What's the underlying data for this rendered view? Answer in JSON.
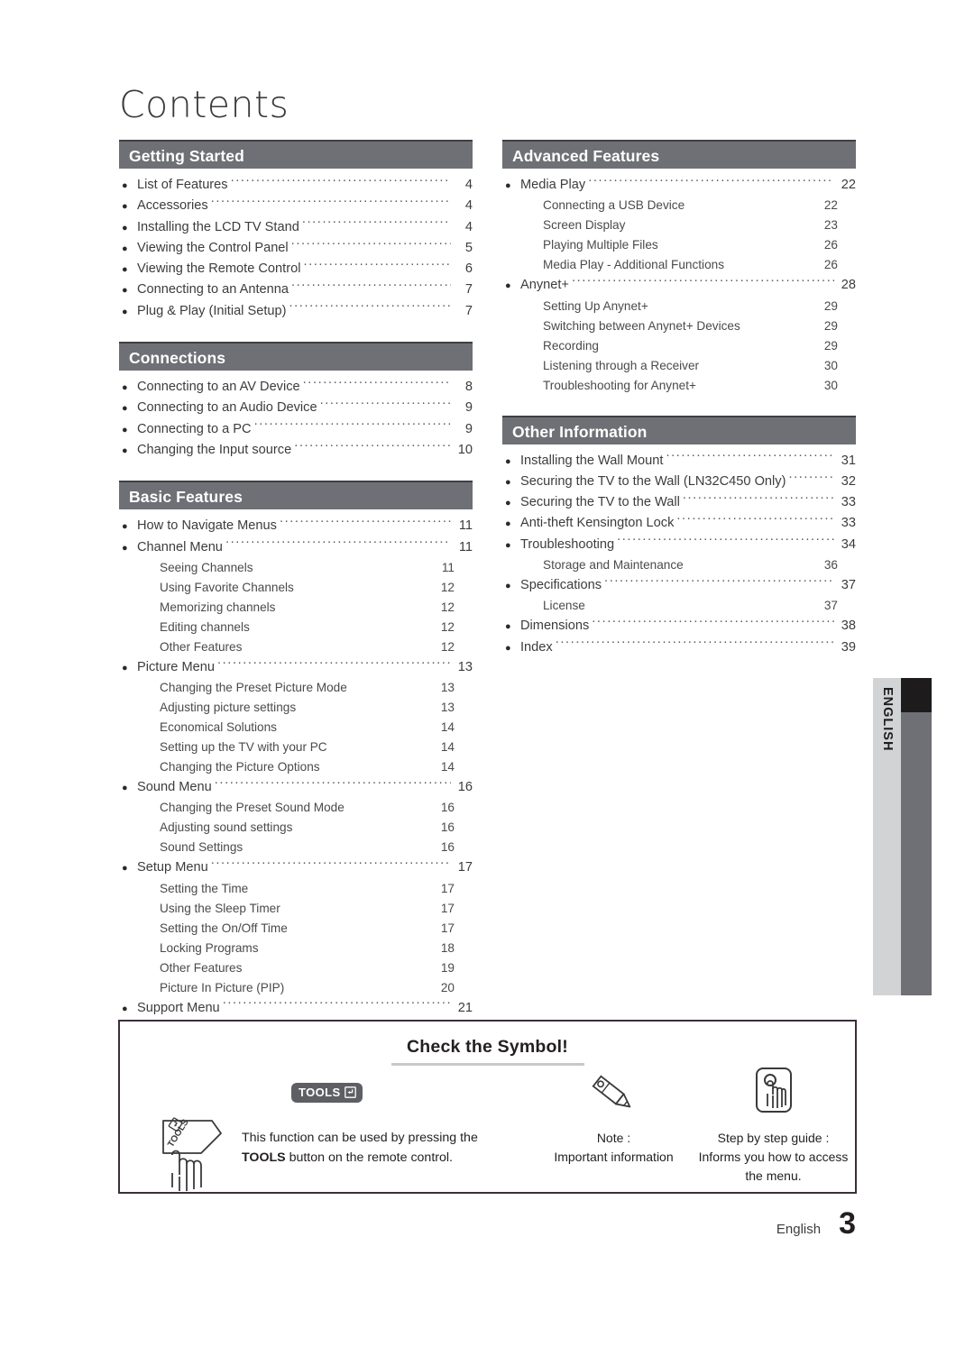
{
  "page": {
    "title": "Contents",
    "footer_language": "English",
    "footer_page_number": "3",
    "side_tab_language": "ENGLISH",
    "accent_bar_color": "#6e7075",
    "bar_top_border_color": "#3f4043",
    "side_tab_bg_color": "#d2d3d5",
    "side_tab_black_color": "#1e1b1c"
  },
  "columns": {
    "left": [
      {
        "heading": "Getting Started",
        "entries": [
          {
            "type": "main",
            "label": "List of Features",
            "page": "4"
          },
          {
            "type": "main",
            "label": "Accessories",
            "page": "4"
          },
          {
            "type": "main",
            "label": "Installing the LCD TV Stand",
            "page": "4"
          },
          {
            "type": "main",
            "label": "Viewing the Control Panel",
            "page": "5"
          },
          {
            "type": "main",
            "label": "Viewing the Remote Control",
            "page": "6"
          },
          {
            "type": "main",
            "label": "Connecting to an Antenna",
            "page": "7"
          },
          {
            "type": "main",
            "label": "Plug & Play (Initial Setup)",
            "page": "7"
          }
        ]
      },
      {
        "heading": "Connections",
        "entries": [
          {
            "type": "main",
            "label": "Connecting to an AV Device",
            "page": "8"
          },
          {
            "type": "main",
            "label": "Connecting to an Audio Device",
            "page": "9"
          },
          {
            "type": "main",
            "label": "Connecting to a PC",
            "page": "9"
          },
          {
            "type": "main",
            "label": "Changing the Input source",
            "page": "10"
          }
        ]
      },
      {
        "heading": "Basic Features",
        "entries": [
          {
            "type": "main",
            "label": "How to Navigate Menus",
            "page": "11"
          },
          {
            "type": "main",
            "label": "Channel Menu",
            "page": "11"
          },
          {
            "type": "sub",
            "label": "Seeing Channels",
            "page": "11"
          },
          {
            "type": "sub",
            "label": "Using Favorite Channels",
            "page": "12"
          },
          {
            "type": "sub",
            "label": "Memorizing channels",
            "page": "12"
          },
          {
            "type": "sub",
            "label": "Editing channels",
            "page": "12"
          },
          {
            "type": "sub",
            "label": "Other Features",
            "page": "12"
          },
          {
            "type": "main",
            "label": "Picture Menu",
            "page": "13"
          },
          {
            "type": "sub",
            "label": "Changing the Preset Picture Mode",
            "page": "13"
          },
          {
            "type": "sub",
            "label": "Adjusting picture settings",
            "page": "13"
          },
          {
            "type": "sub",
            "label": "Economical Solutions",
            "page": "14"
          },
          {
            "type": "sub",
            "label": "Setting up the TV with your PC",
            "page": "14"
          },
          {
            "type": "sub",
            "label": "Changing the Picture Options",
            "page": "14"
          },
          {
            "type": "main",
            "label": "Sound Menu",
            "page": "16"
          },
          {
            "type": "sub",
            "label": "Changing the Preset Sound Mode",
            "page": "16"
          },
          {
            "type": "sub",
            "label": "Adjusting sound settings",
            "page": "16"
          },
          {
            "type": "sub",
            "label": "Sound Settings",
            "page": "16"
          },
          {
            "type": "main",
            "label": "Setup Menu",
            "page": "17"
          },
          {
            "type": "sub",
            "label": "Setting the Time",
            "page": "17"
          },
          {
            "type": "sub",
            "label": "Using the Sleep Timer",
            "page": "17"
          },
          {
            "type": "sub",
            "label": "Setting the On/Off Time",
            "page": "17"
          },
          {
            "type": "sub",
            "label": "Locking Programs",
            "page": "18"
          },
          {
            "type": "sub",
            "label": "Other Features",
            "page": "19"
          },
          {
            "type": "sub",
            "label": "Picture In Picture (PIP)",
            "page": "20"
          },
          {
            "type": "main",
            "label": "Support Menu",
            "page": "21"
          }
        ]
      }
    ],
    "right": [
      {
        "heading": "Advanced Features",
        "entries": [
          {
            "type": "main",
            "label": "Media Play",
            "page": "22"
          },
          {
            "type": "sub",
            "label": "Connecting a USB Device",
            "page": "22"
          },
          {
            "type": "sub",
            "label": "Screen Display",
            "page": "23"
          },
          {
            "type": "sub",
            "label": "Playing Multiple Files",
            "page": "26"
          },
          {
            "type": "sub",
            "label": "Media Play - Additional Functions",
            "page": "26"
          },
          {
            "type": "main",
            "label": "Anynet+",
            "page": "28"
          },
          {
            "type": "sub",
            "label": "Setting Up Anynet+",
            "page": "29"
          },
          {
            "type": "sub",
            "label": "Switching between Anynet+ Devices",
            "page": "29"
          },
          {
            "type": "sub",
            "label": "Recording",
            "page": "29"
          },
          {
            "type": "sub",
            "label": "Listening through a Receiver",
            "page": "30"
          },
          {
            "type": "sub",
            "label": "Troubleshooting for Anynet+",
            "page": "30"
          }
        ]
      },
      {
        "heading": "Other Information",
        "entries": [
          {
            "type": "main",
            "label": "Installing the Wall Mount",
            "page": "31"
          },
          {
            "type": "main",
            "label": "Securing the TV to the Wall (LN32C450 Only)",
            "page": "32"
          },
          {
            "type": "main",
            "label": "Securing the TV to the Wall",
            "page": "33"
          },
          {
            "type": "main",
            "label": "Anti-theft Kensington Lock",
            "page": "33"
          },
          {
            "type": "main",
            "label": "Troubleshooting",
            "page": "34"
          },
          {
            "type": "sub",
            "label": "Storage and Maintenance",
            "page": "36"
          },
          {
            "type": "main",
            "label": "Specifications",
            "page": "37"
          },
          {
            "type": "sub",
            "label": "License",
            "page": "37"
          },
          {
            "type": "main",
            "label": "Dimensions",
            "page": "38"
          },
          {
            "type": "main",
            "label": "Index",
            "page": "39"
          }
        ]
      }
    ]
  },
  "symbol_box": {
    "title": "Check the Symbol!",
    "items": [
      {
        "icon": "tools-badge-icon",
        "badge_label": "TOOLS",
        "text_line1": "This function can be used by pressing the",
        "text_bold": "TOOLS",
        "text_line2_rest": " button on the remote control."
      },
      {
        "icon": "pencil-icon",
        "caption_line1": "Note :",
        "caption_line2": "Important information"
      },
      {
        "icon": "press-button-hand-icon",
        "caption_line1": "Step by step guide :",
        "caption_line2": "Informs you how to access",
        "caption_line3": "the menu."
      }
    ]
  }
}
